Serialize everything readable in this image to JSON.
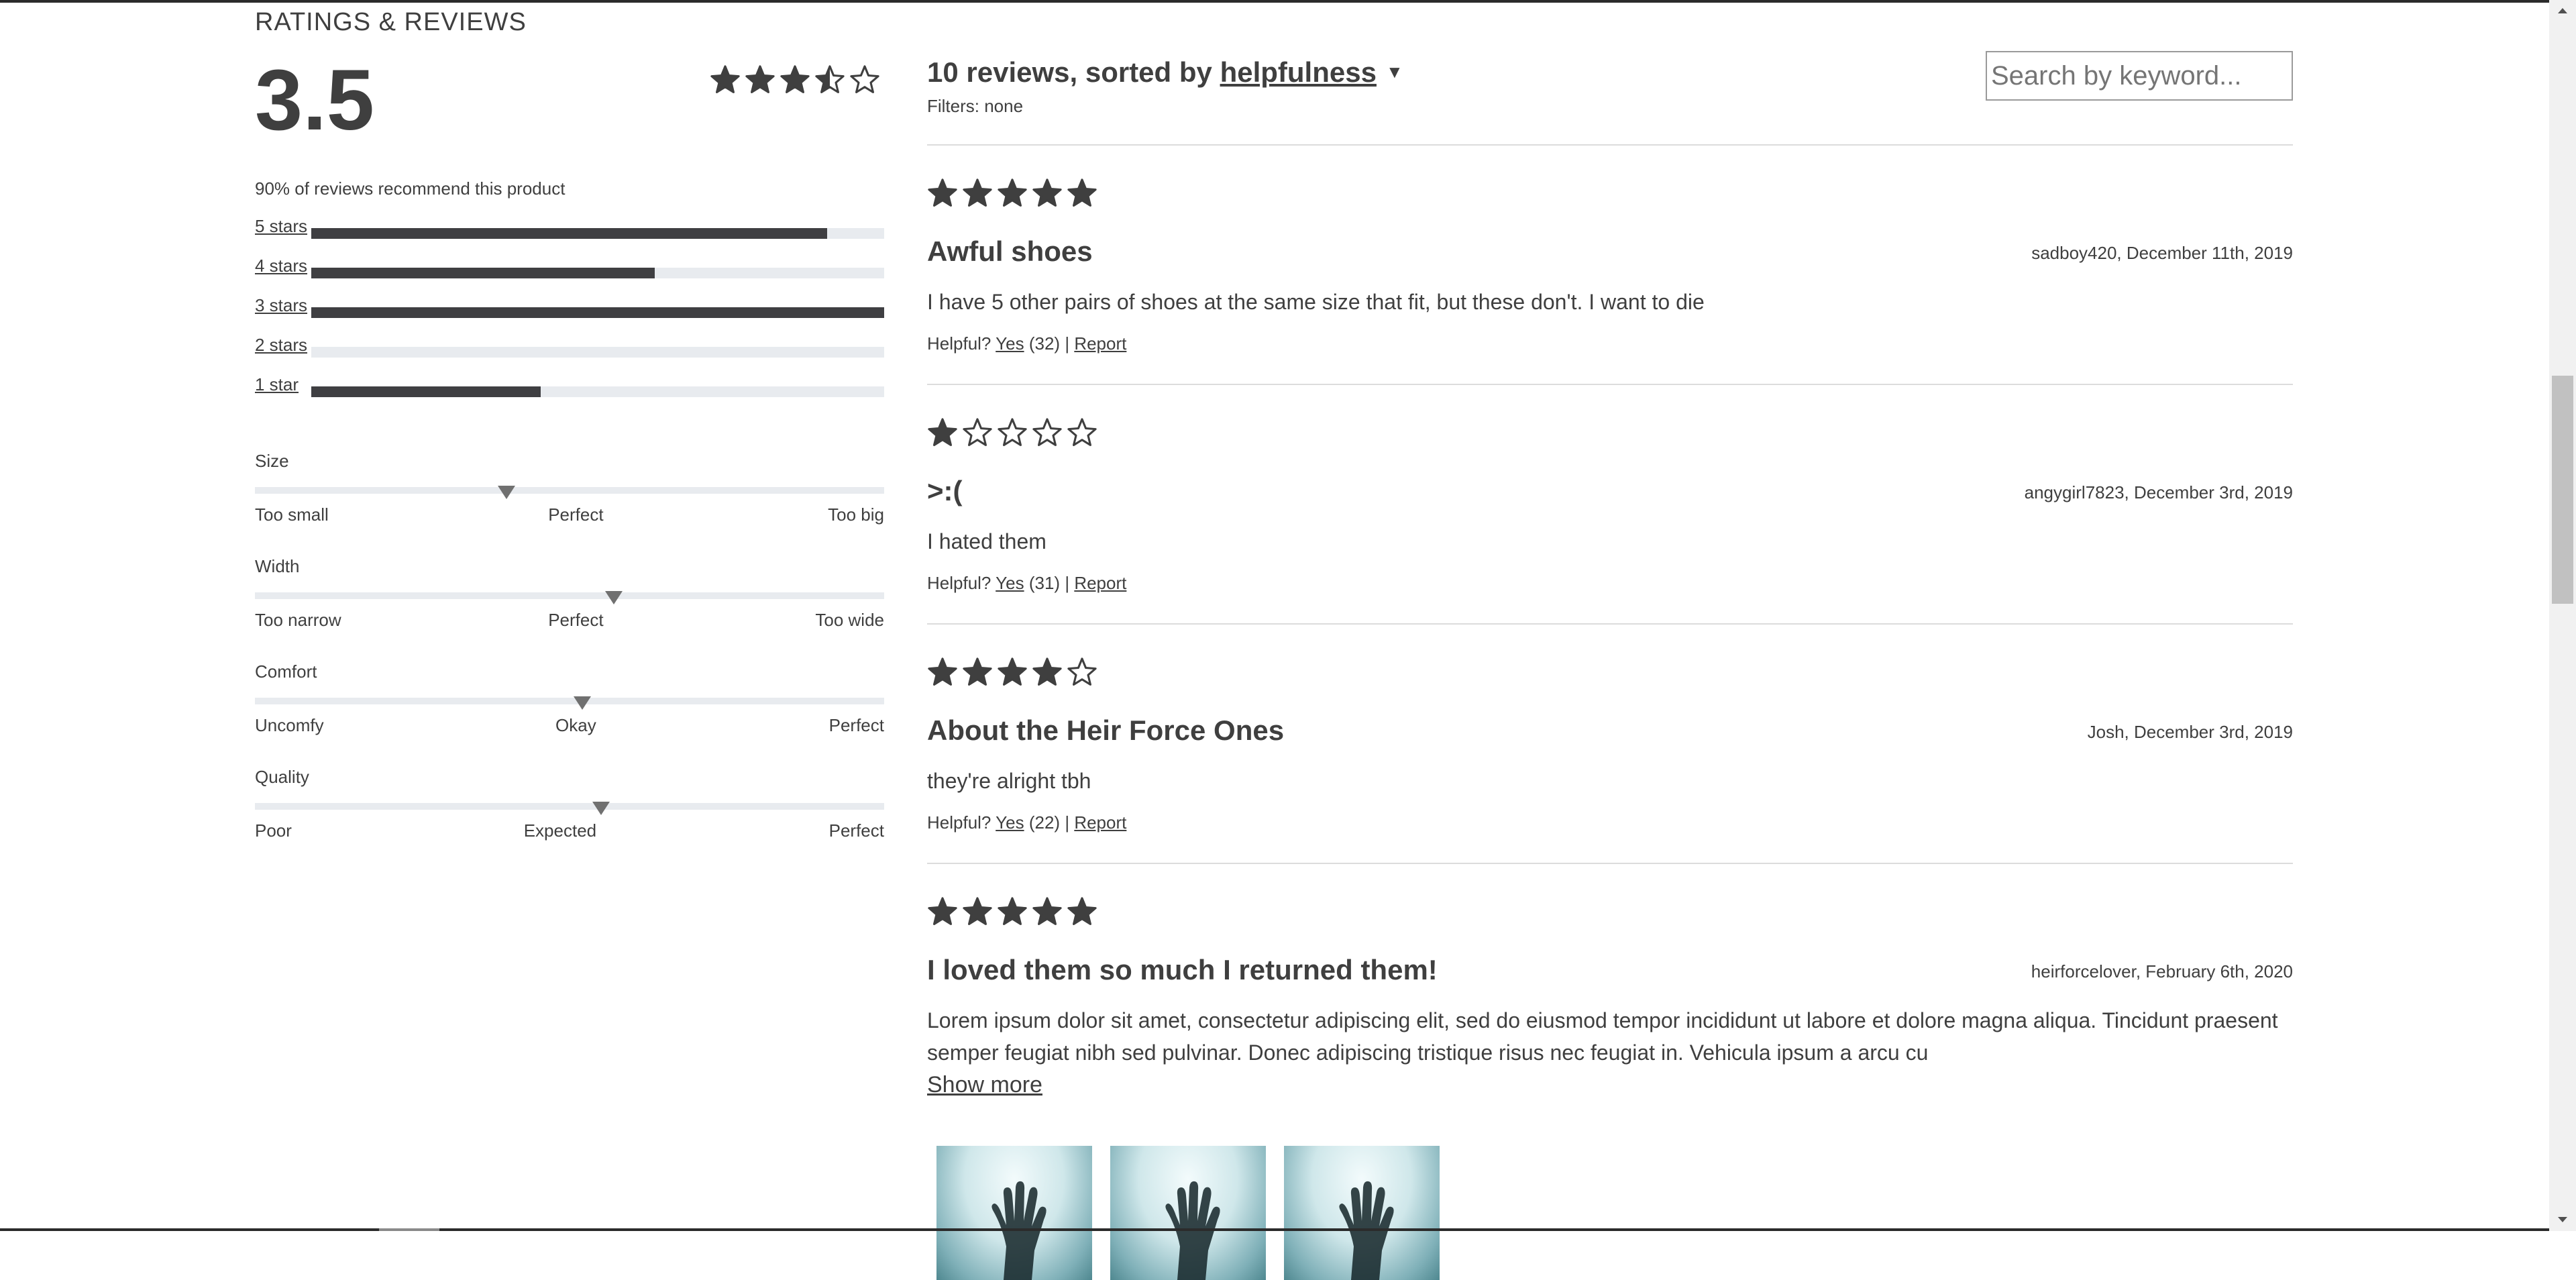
{
  "ratings": {
    "section_title": "RATINGS & REVIEWS",
    "average": "3.5",
    "average_stars": 3.5,
    "recommend_text": "90% of reviews recommend this product",
    "breakdown": [
      {
        "label": "5 stars",
        "fraction": 0.9
      },
      {
        "label": "4 stars",
        "fraction": 0.6
      },
      {
        "label": "3 stars",
        "fraction": 1.0
      },
      {
        "label": "2 stars",
        "fraction": 0.0
      },
      {
        "label": "1 star",
        "fraction": 0.4
      }
    ],
    "characteristics": [
      {
        "name": "Size",
        "value": 0.4,
        "labels": [
          "Too small",
          "Perfect",
          "Too big"
        ]
      },
      {
        "name": "Width",
        "value": 0.57,
        "labels": [
          "Too narrow",
          "Perfect",
          "Too wide"
        ]
      },
      {
        "name": "Comfort",
        "value": 0.52,
        "labels": [
          "Uncomfy",
          "Okay",
          "Perfect"
        ]
      },
      {
        "name": "Quality",
        "value": 0.55,
        "labels": [
          "Poor",
          "Expected",
          "Perfect"
        ]
      }
    ]
  },
  "reviews": {
    "count_text": "10 reviews, sorted by",
    "sort_by": "helpfulness",
    "sort_caret": "▼",
    "filters_text": "Filters: none",
    "search_placeholder": "Search by keyword...",
    "items": [
      {
        "rating": 5,
        "title": "Awful shoes",
        "meta": "sadboy420, December 11th, 2019",
        "body": "I have 5 other pairs of shoes at the same size that fit, but these don't. I want to die",
        "helpful_label": "Helpful?",
        "yes_label": "Yes",
        "yes_count": "(32)",
        "separator": "|",
        "report_label": "Report"
      },
      {
        "rating": 1,
        "title": ">:(",
        "meta": "angygirl7823, December 3rd, 2019",
        "body": "I hated them",
        "helpful_label": "Helpful?",
        "yes_label": "Yes",
        "yes_count": "(31)",
        "separator": "|",
        "report_label": "Report"
      },
      {
        "rating": 4,
        "title": "About the Heir Force Ones",
        "meta": "Josh, December 3rd, 2019",
        "body": "they're alright tbh",
        "helpful_label": "Helpful?",
        "yes_label": "Yes",
        "yes_count": "(22)",
        "separator": "|",
        "report_label": "Report"
      },
      {
        "rating": 5,
        "title": "I loved them so much I returned them!",
        "meta": "heirforcelover, February 6th, 2020",
        "body": "Lorem ipsum dolor sit amet, consectetur adipiscing elit, sed do eiusmod tempor incididunt ut labore et dolore magna aliqua. Tincidunt praesent semper feugiat nibh sed pulvinar. Donec adipiscing tristique risus nec feugiat in. Vehicula ipsum a arcu cu",
        "show_more": "Show more"
      }
    ]
  },
  "colors": {
    "star": "#3f3f3f",
    "bar_fill": "#3f3f42",
    "bar_track": "#e8ebef"
  }
}
